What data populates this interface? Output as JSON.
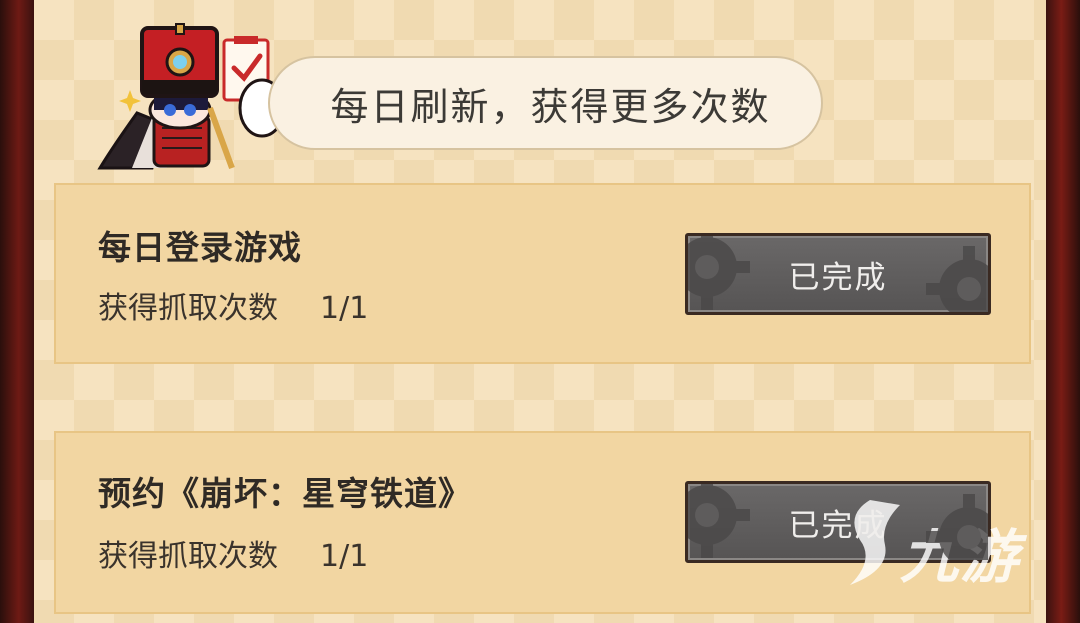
{
  "header": {
    "bubble_text": "每日刷新，获得更多次数"
  },
  "tasks": [
    {
      "title": "每日登录游戏",
      "reward_label": "获得抓取次数",
      "progress": "1/1",
      "status_button": "已完成"
    },
    {
      "title": "预约《崩坏：星穹铁道》",
      "reward_label": "获得抓取次数",
      "progress": "1/1",
      "status_button": "已完成"
    }
  ],
  "watermark": {
    "text": "九游"
  },
  "icons": {
    "mascot": "conductor-mascot-with-clipboard",
    "button_decoration": "gear-icon",
    "watermark_logo": "jiuyou-logo-icon"
  },
  "colors": {
    "panel_bg": "#f6e3c0",
    "card_bg": "#f2d6a2",
    "button_bg": "#5e5c5c",
    "frame": "#6e1a14"
  }
}
